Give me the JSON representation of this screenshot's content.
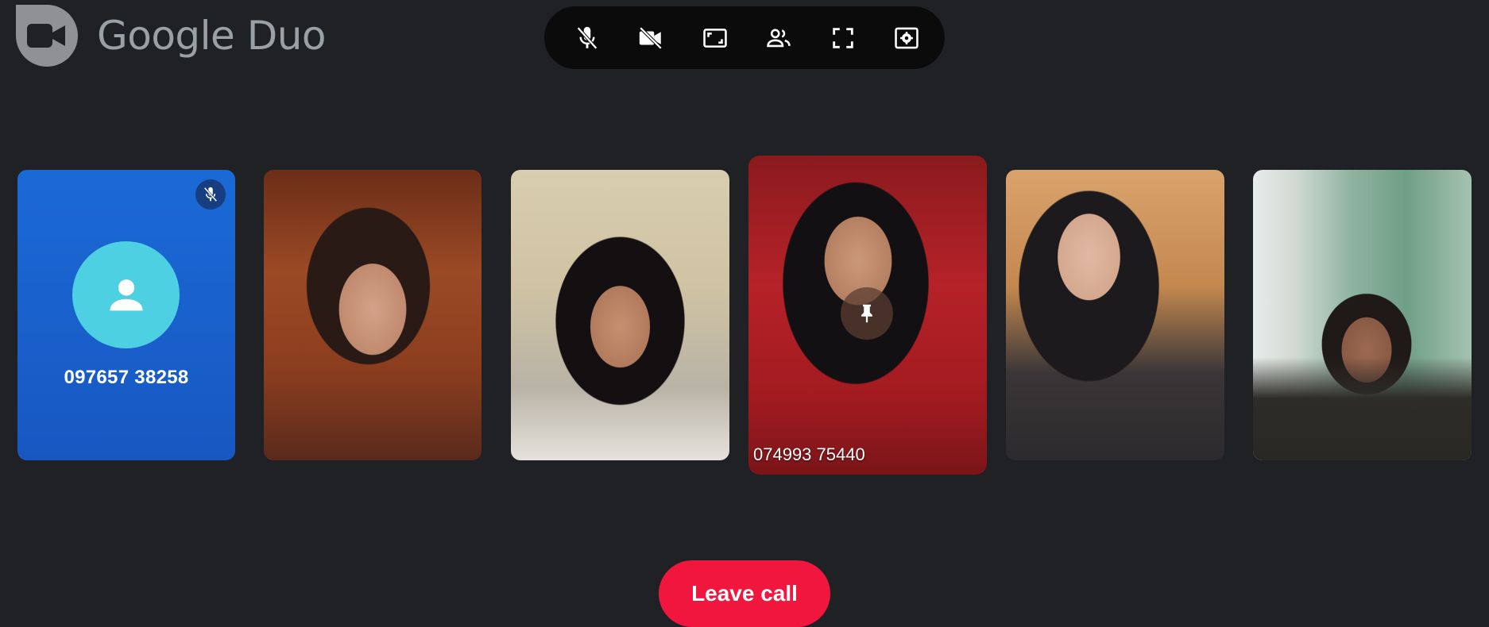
{
  "app": {
    "title": "Google Duo"
  },
  "toolbar": {
    "buttons": [
      {
        "icon": "mic-off-icon",
        "name": "mute-mic-button"
      },
      {
        "icon": "video-off-icon",
        "name": "camera-off-button"
      },
      {
        "icon": "aspect-ratio-icon",
        "name": "layout-button"
      },
      {
        "icon": "people-icon",
        "name": "participants-button"
      },
      {
        "icon": "fullscreen-icon",
        "name": "fullscreen-button"
      },
      {
        "icon": "settings-icon",
        "name": "settings-button"
      }
    ]
  },
  "tiles": {
    "self": {
      "number": "097657 38258",
      "muted": true,
      "avatar_color": "#4dd0e1"
    },
    "pinned": {
      "label": "074993 75440"
    }
  },
  "actions": {
    "leave_label": "Leave call"
  },
  "colors": {
    "background": "#202124",
    "toolbar": "#0b0b0c",
    "leave": "#f0163e",
    "self_tile": "#1a6ad6"
  }
}
